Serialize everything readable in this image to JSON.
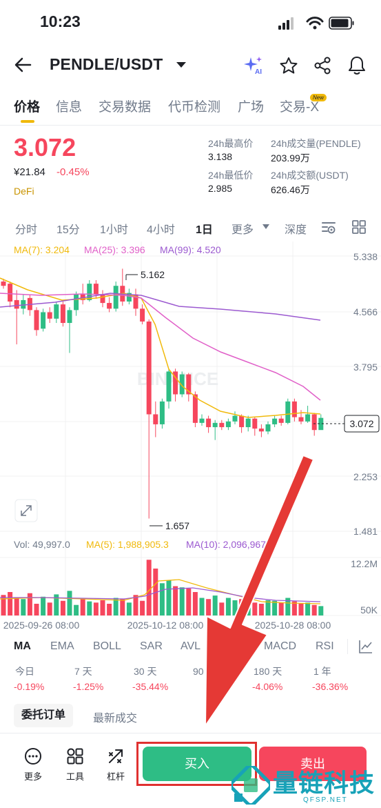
{
  "status_bar": {
    "time": "10:23"
  },
  "header": {
    "pair": "PENDLE/USDT"
  },
  "tabs": [
    {
      "label": "价格"
    },
    {
      "label": "信息"
    },
    {
      "label": "交易数据"
    },
    {
      "label": "代币检测"
    },
    {
      "label": "广场"
    },
    {
      "label": "交易-X"
    }
  ],
  "new_badge": "New",
  "price": {
    "last": "3.072",
    "cny": "¥21.84",
    "change": "-0.45%",
    "sector": "DeFi"
  },
  "stats": {
    "high_label": "24h最高价",
    "high_value": "3.138",
    "low_label": "24h最低价",
    "low_value": "2.985",
    "vol_label": "24h成交量(PENDLE)",
    "vol_value": "203.99万",
    "amt_label": "24h成交额(USDT)",
    "amt_value": "626.46万"
  },
  "intervals": [
    "分时",
    "15分",
    "1小时",
    "4小时",
    "1日",
    "更多",
    "深度"
  ],
  "ma_legend": {
    "ma7": "MA(7): 3.204",
    "ma25": "MA(25): 3.396",
    "ma99": "MA(99): 4.520"
  },
  "vol_legend": {
    "vol": "Vol: 49,997.0",
    "ma5": "MA(5): 1,988,905.3",
    "ma10": "MA(10): 2,096,967"
  },
  "colors": {
    "up": "#2ebd85",
    "down": "#f6465d",
    "ma7": "#f0b90b",
    "ma25": "#e05fc8",
    "ma99": "#9b59d0"
  },
  "chart_data": {
    "type": "candlestick",
    "y_axis_labels": [
      "5.338",
      "4.566",
      "3.795",
      "3.072",
      "2.253",
      "1.481"
    ],
    "volume_axis_labels": [
      "12.2M",
      "50K"
    ],
    "x_axis_labels": [
      "2025-09-26 08:00",
      "2025-10-12 08:00",
      "2025-10-28 08:00"
    ],
    "high_marker": "5.162",
    "low_marker": "1.657",
    "current_price": "3.072",
    "watermark": "BINANCE",
    "ylim": [
      1.481,
      5.338
    ]
  },
  "indicators": [
    "MA",
    "EMA",
    "BOLL",
    "SAR",
    "AVL",
    "VOL",
    "MACD",
    "RSI"
  ],
  "performance": [
    {
      "label": "今日",
      "value": "-0.19%"
    },
    {
      "label": "7 天",
      "value": "-1.25%"
    },
    {
      "label": "30 天",
      "value": "-35.44%"
    },
    {
      "label": "90 天",
      "value": ""
    },
    {
      "label": "180 天",
      "value": "-4.06%"
    },
    {
      "label": "1 年",
      "value": "-36.36%"
    }
  ],
  "order_tabs": {
    "orders": "委托订单",
    "trades": "最新成交"
  },
  "bottom": {
    "more": "更多",
    "tools": "工具",
    "leverage": "杠杆",
    "buy": "买入",
    "sell": "卖出"
  },
  "watermark_brand": {
    "name": "量链科技",
    "domain": "QFSP.NET"
  }
}
